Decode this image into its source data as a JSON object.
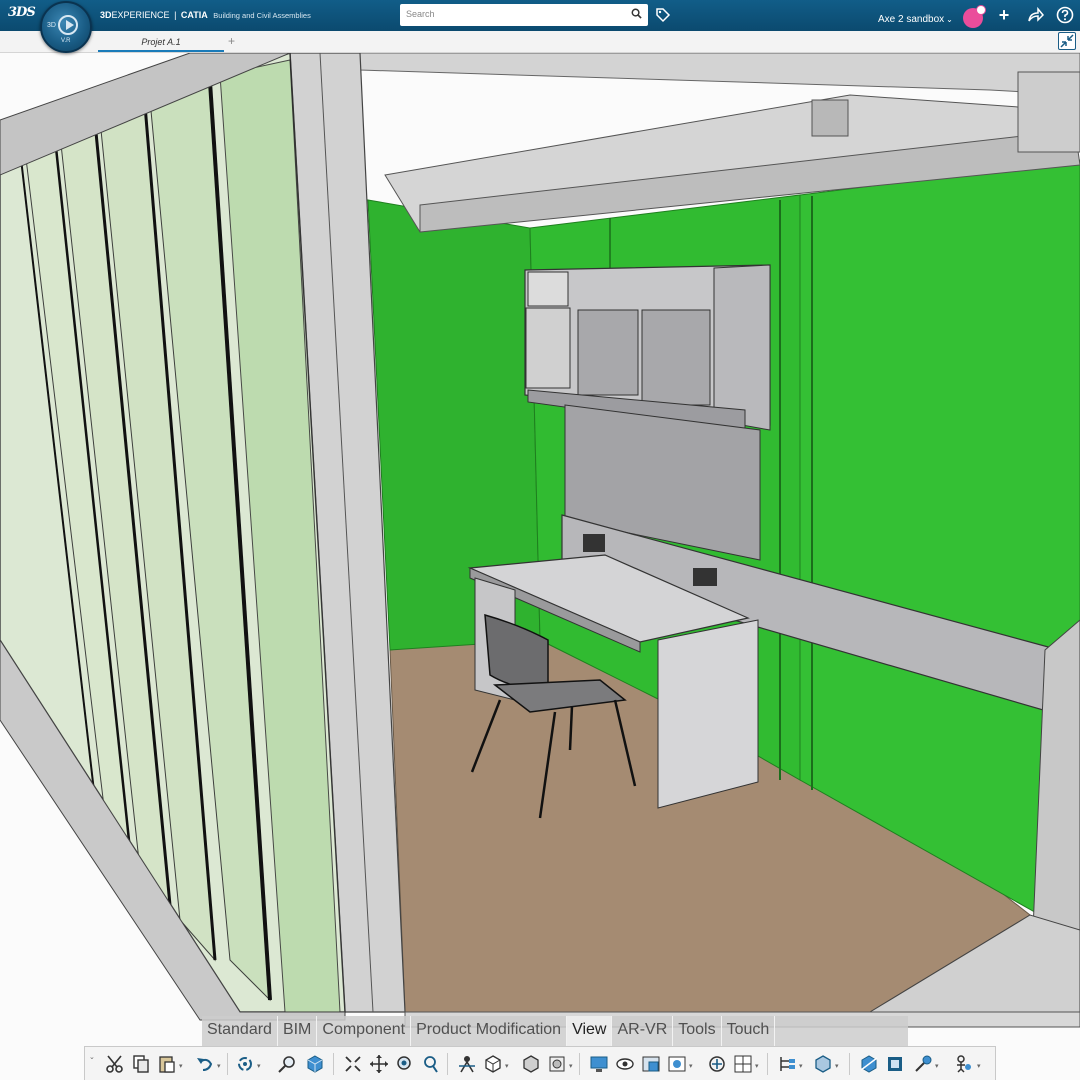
{
  "header": {
    "brand_logo": "3DS",
    "compass_left": "3D",
    "compass_bottom": "V.R",
    "brand": "3D",
    "brand_rest": "EXPERIENCE",
    "separator": "|",
    "app_name": "CATIA",
    "app_subtitle": "Building and Civil Assemblies",
    "search_placeholder": "Search",
    "space_label": "Axe 2 sandbox",
    "icons": [
      "tag-icon",
      "add-icon",
      "share-icon",
      "help-icon"
    ]
  },
  "document": {
    "tab_label": "Projet A.1",
    "add_tab_label": "+"
  },
  "section_tabs": [
    {
      "label": "Standard",
      "active": false
    },
    {
      "label": "BIM",
      "active": false
    },
    {
      "label": "Component",
      "active": false
    },
    {
      "label": "Product Modification",
      "active": false
    },
    {
      "label": "View",
      "active": true
    },
    {
      "label": "AR-VR",
      "active": false
    },
    {
      "label": "Tools",
      "active": false
    },
    {
      "label": "Touch",
      "active": false
    }
  ],
  "action_bar_icons": [
    "cut-icon",
    "copy-icon",
    "paste-icon",
    "undo-icon",
    "rotate-icon",
    "zoom-icon",
    "cube-icon",
    "fit-all-icon",
    "pan-icon",
    "zoom-area-icon",
    "zoom-in-out-icon",
    "normal-view-icon",
    "iso-view-icon",
    "shading-icon",
    "render-style-icon",
    "display-screen-icon",
    "hide-show-icon",
    "swap-visible-icon",
    "capture-icon",
    "explode-icon",
    "multi-view-icon",
    "tree-icon",
    "part-icon",
    "section-icon",
    "measure-icon",
    "pin-icon",
    "robot-icon"
  ],
  "colors": {
    "topbar": "#0b4a6f",
    "green_wall": "#2fba2f",
    "floor": "#a48c72",
    "frame": "#cfcfcf"
  }
}
